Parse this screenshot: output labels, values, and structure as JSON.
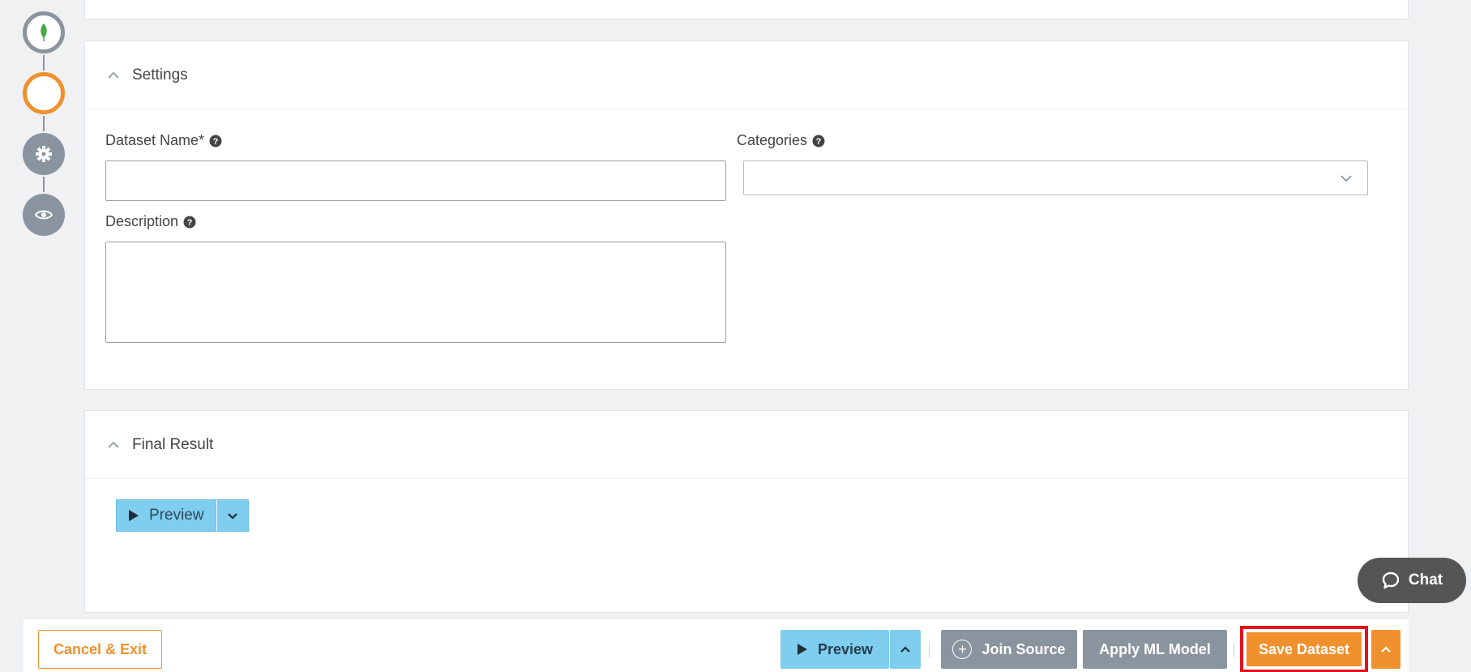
{
  "rail": {
    "steps": [
      {
        "icon": "leaf-icon",
        "state": "complete"
      },
      {
        "icon": "circle-icon",
        "state": "active"
      },
      {
        "icon": "gear-icon",
        "state": "pending"
      },
      {
        "icon": "eye-icon",
        "state": "pending"
      }
    ]
  },
  "settings": {
    "title": "Settings",
    "dataset_name": {
      "label": "Dataset Name*",
      "value": ""
    },
    "categories": {
      "label": "Categories",
      "value": ""
    },
    "description": {
      "label": "Description",
      "value": ""
    }
  },
  "final_result": {
    "title": "Final Result",
    "preview_label": "Preview"
  },
  "chat": {
    "label": "Chat"
  },
  "footer": {
    "cancel_label": "Cancel & Exit",
    "preview_label": "Preview",
    "join_label": "Join Source",
    "apply_label": "Apply ML Model",
    "save_label": "Save Dataset"
  },
  "colors": {
    "accent_orange": "#f0912e",
    "preview_blue": "#7fcdef",
    "neutral_gray": "#8a949e",
    "highlight_red": "#e0141e"
  }
}
